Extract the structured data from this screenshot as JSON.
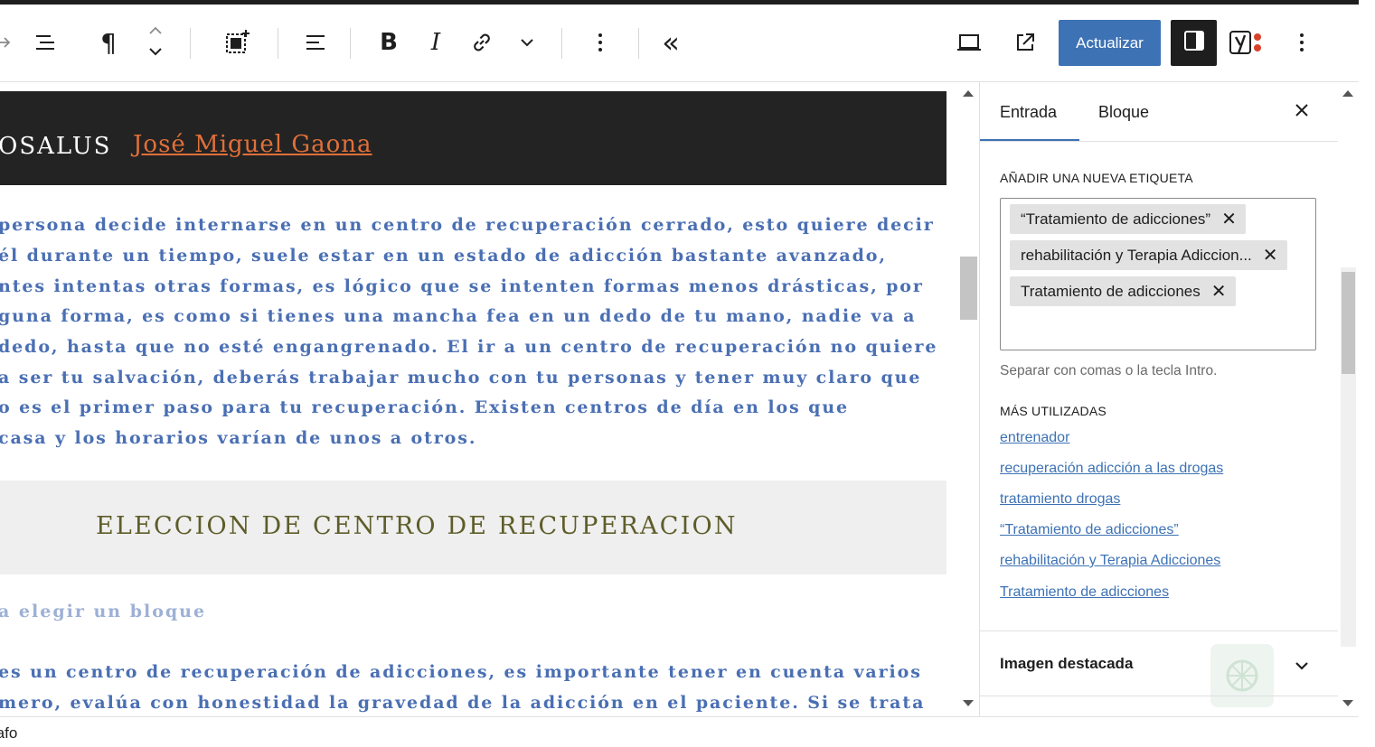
{
  "toolbar": {
    "update_label": "Actualizar",
    "icons": [
      "redo-icon",
      "list-view-icon",
      "paragraph-icon",
      "move-arrows-icon",
      "select-block-icon",
      "align-icon",
      "bold-icon",
      "italic-icon",
      "link-icon",
      "more-format-icon",
      "options-icon",
      "collapse-icon",
      "preview-icon",
      "external-link-icon",
      "settings-icon",
      "yoast-icon",
      "more-menu-icon"
    ],
    "bold_glyph": "B",
    "italic_glyph": "I",
    "paragraph_glyph": "¶",
    "collapse_glyph": "«"
  },
  "editor": {
    "banner_text": "OSALUS",
    "banner_author": "José Miguel Gaona",
    "paragraph_lines": [
      "persona decide internarse en un centro de recuperación cerrado, esto quiere decir",
      "él durante un tiempo, suele estar en un estado de adicción bastante avanzado,",
      "ntes intentas otras formas, es lógico que se intenten formas menos drásticas, por",
      "guna forma, es como si tienes una mancha fea en un dedo de tu mano, nadie va a",
      "dedo, hasta que no esté engangrenado. El ir a un centro de recuperación no quiere",
      " a ser tu salvación, deberás trabajar mucho con tu personas y tener muy claro que",
      "o es el primer paso para tu recuperación. Existen centros de día en los que",
      "casa y los horarios varían de unos a otros."
    ],
    "heading": "ELECCION DE CENTRO DE RECUPERACION",
    "block_placeholder": "a elegir un bloque",
    "paragraph2_lines": [
      "es un centro de recuperación de adicciones, es importante tener en cuenta varios",
      "mero, evalúa con honestidad la gravedad de la adicción en el paciente. Si se trata"
    ]
  },
  "sidebar": {
    "tab_post": "Entrada",
    "tab_block": "Bloque",
    "new_tag_label": "AÑADIR UNA NUEVA ETIQUETA",
    "tokens": [
      "“Tratamiento de adicciones”",
      "rehabilitación y Terapia Adiccion...",
      "Tratamiento de adicciones"
    ],
    "token_remove_glyph": "✕",
    "help_text": "Separar con comas o la tecla Intro.",
    "most_used_label": "MÁS UTILIZADAS",
    "most_used": [
      "entrenador",
      "recuperación adicción a las drogas",
      "tratamiento drogas",
      "“Tratamiento de adicciones”",
      "rehabilitación y Terapia Adicciones",
      "Tratamiento de adicciones"
    ],
    "featured_image_label": "Imagen destacada"
  },
  "footer": {
    "breadcrumb": "rafo"
  },
  "colors": {
    "accent": "#3d72b4",
    "paragraph_text": "#4a6fb3",
    "author_link": "#e0703a",
    "heading_text": "#5e5d2a"
  }
}
